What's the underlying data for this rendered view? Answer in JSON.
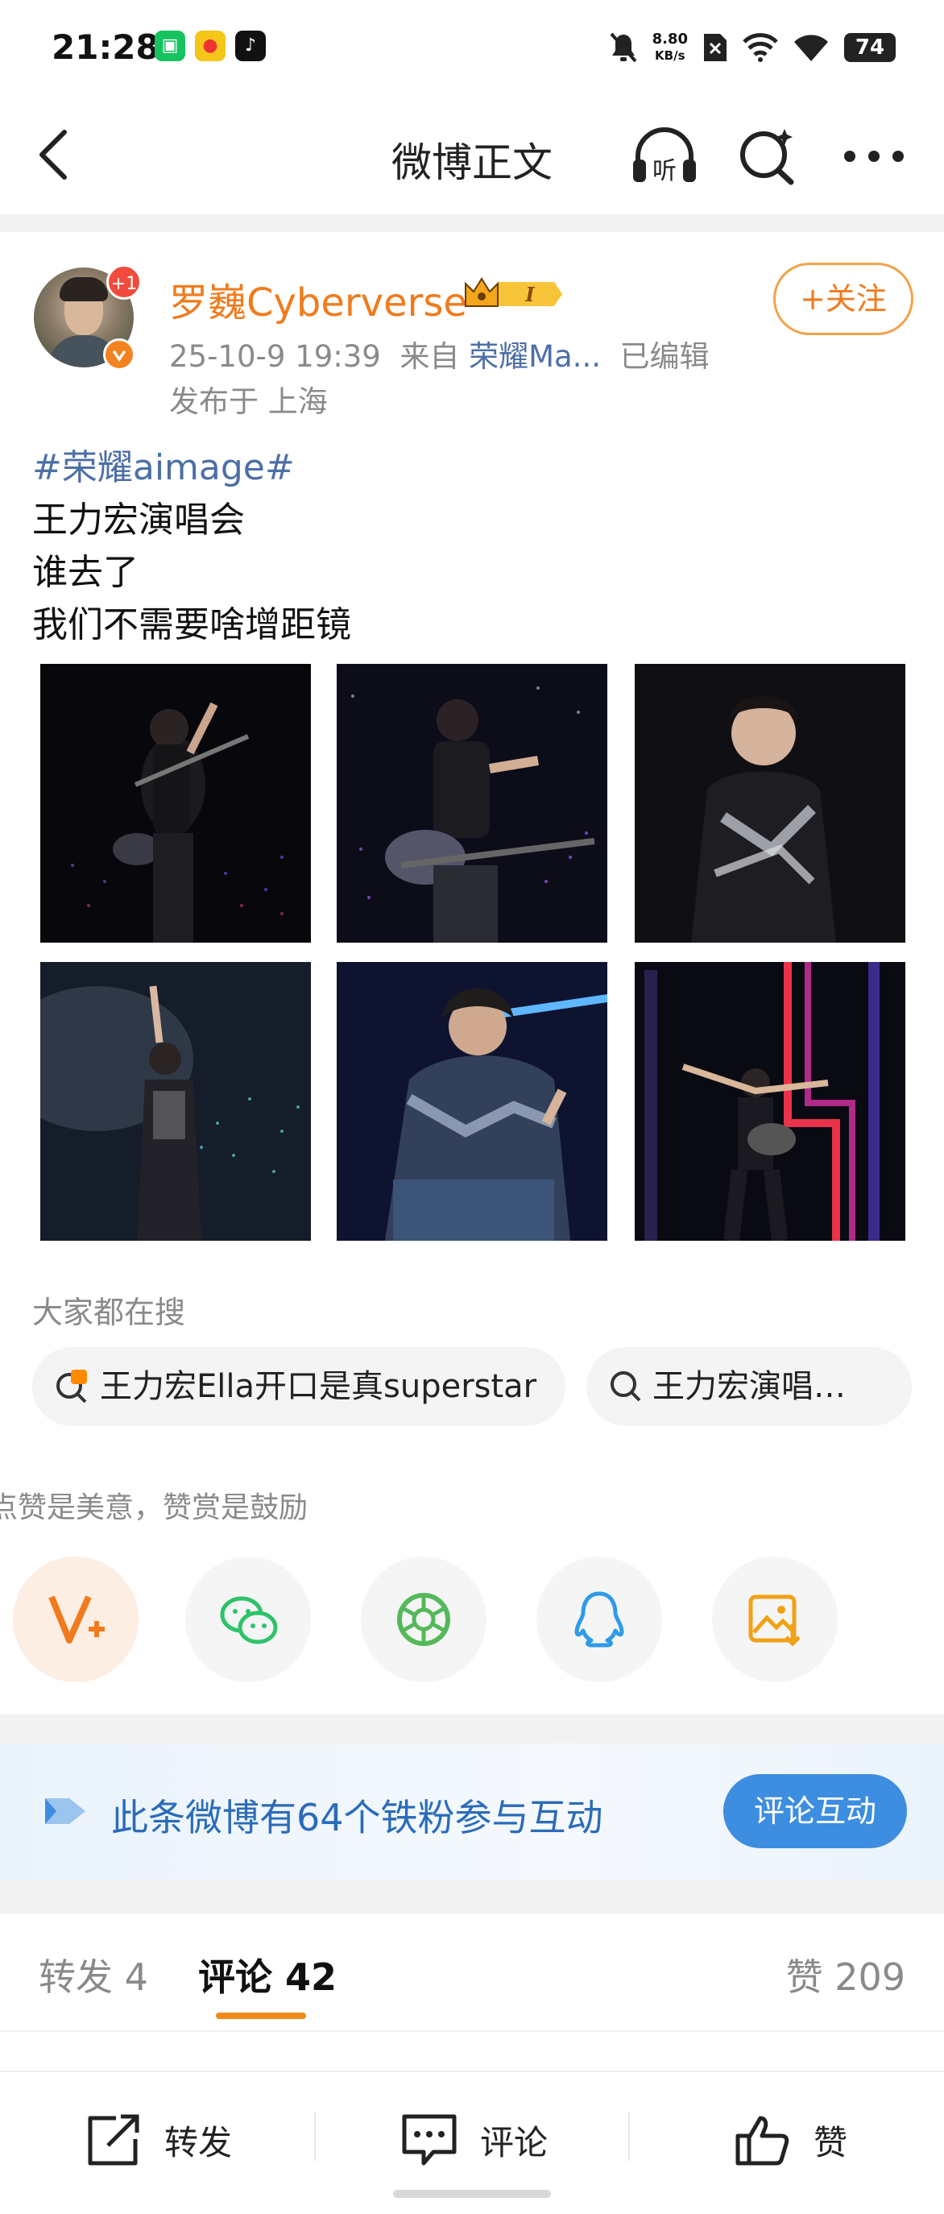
{
  "status_bar": {
    "time": "21:28",
    "net_speed_value": "8.80",
    "net_speed_unit": "KB/s",
    "battery": "74",
    "app_icons": [
      "wechat-mini-icon",
      "weibo-icon",
      "douyin-icon"
    ],
    "right_icons": [
      "mute-icon",
      "no-sim-icon",
      "signal-icon",
      "wifi-icon",
      "battery-icon"
    ]
  },
  "header": {
    "title": "微博正文",
    "listen_label": "听"
  },
  "post": {
    "author": "罗巍Cyberverse",
    "avatar_badge": "+1",
    "vip_label": "I",
    "follow_label": "+关注",
    "date": "25-10-9 19:39",
    "source_prefix": "来自",
    "source": "荣耀Ma...",
    "edited": "已编辑",
    "location": "发布于 上海",
    "hashtag": "#荣耀aimage#",
    "lines": [
      "王力宏演唱会",
      "谁去了",
      "我们不需要啥增距镜"
    ],
    "photo_count": 6
  },
  "searching": {
    "title": "大家都在搜",
    "chips": [
      {
        "text": "王力宏Ella开口是真superstar",
        "icon": "hot-search-icon"
      },
      {
        "text": "王力宏演唱…",
        "icon": "search-icon"
      }
    ]
  },
  "share": {
    "hint": "点赞是美意，赞赏是鼓励",
    "buttons": [
      "appreciate-v-icon",
      "wechat-icon",
      "moments-icon",
      "qq-icon",
      "save-image-icon"
    ]
  },
  "fan_banner": {
    "text": "此条微博有64个铁粉参与互动",
    "button": "评论互动"
  },
  "tabs": {
    "repost": "转发 4",
    "comment": "评论 42",
    "like": "赞 209"
  },
  "bottom_bar": {
    "repost": "转发",
    "comment": "评论",
    "like": "赞"
  },
  "colors": {
    "username": "#f07b1d",
    "link": "#4d6fa6",
    "accent_blue": "#3d8de0",
    "tab_indicator": "#f08a1c"
  }
}
